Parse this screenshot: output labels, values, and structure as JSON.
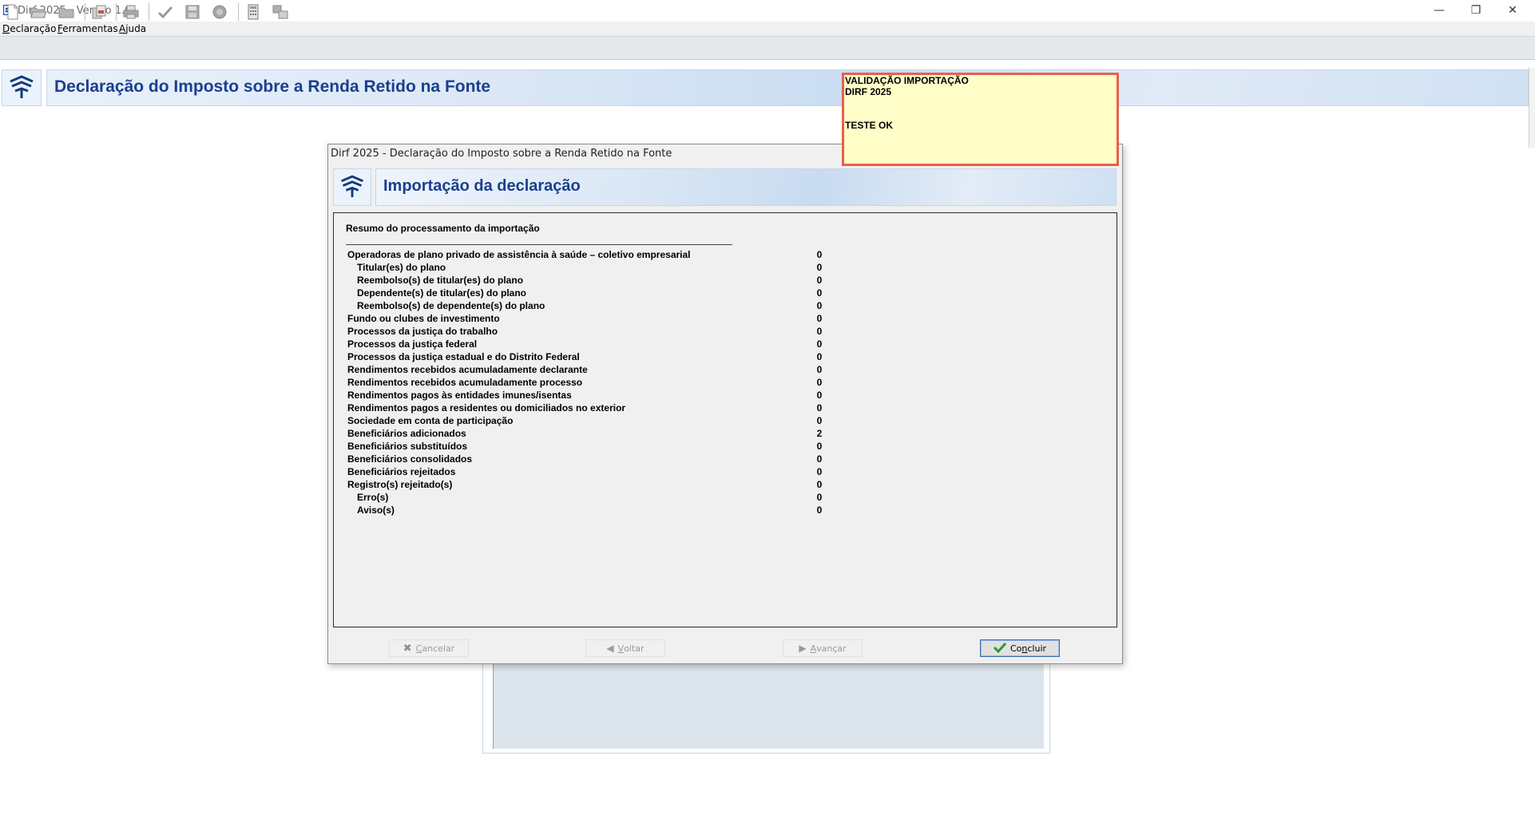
{
  "window": {
    "title": "Dirf 2025 - Versão 1.0",
    "minimize": "—",
    "restore": "❐",
    "close": "✕"
  },
  "menu": {
    "items": [
      {
        "underline": "D",
        "rest": "eclaração"
      },
      {
        "underline": "F",
        "rest": "erramentas"
      },
      {
        "underline": "A",
        "rest": "juda"
      }
    ]
  },
  "toolbar": {
    "icons": [
      "new-document-icon",
      "open-folder-icon",
      "folder-icon",
      "copy-icon",
      "print-icon",
      "check-icon",
      "save-icon",
      "stamp-icon",
      "calculator-icon",
      "transmit-icon"
    ]
  },
  "main": {
    "title": "Declaração do Imposto sobre a Renda Retido na Fonte"
  },
  "dialog": {
    "title": "Dirf 2025 - Declaração do Imposto sobre a Renda Retido na Fonte",
    "heading": "Importação da declaração",
    "summary_heading": "Resumo do processamento da importação",
    "rows": [
      {
        "label": "Operadoras de plano privado de assistência à saúde – coletivo empresarial",
        "value": "0",
        "indent": 0
      },
      {
        "label": "Titular(es) do plano",
        "value": "0",
        "indent": 1
      },
      {
        "label": "Reembolso(s) de titular(es) do plano",
        "value": "0",
        "indent": 1
      },
      {
        "label": "Dependente(s) de titular(es) do plano",
        "value": "0",
        "indent": 1
      },
      {
        "label": "Reembolso(s) de dependente(s) do plano",
        "value": "0",
        "indent": 1
      },
      {
        "label": "Fundo ou clubes de investimento",
        "value": "0",
        "indent": 0
      },
      {
        "label": "Processos da justiça do trabalho",
        "value": "0",
        "indent": 0
      },
      {
        "label": "Processos da justiça federal",
        "value": "0",
        "indent": 0
      },
      {
        "label": "Processos da justiça estadual e do Distrito Federal",
        "value": "0",
        "indent": 0
      },
      {
        "label": "Rendimentos recebidos acumuladamente declarante",
        "value": "0",
        "indent": 0
      },
      {
        "label": "Rendimentos recebidos acumuladamente processo",
        "value": "0",
        "indent": 0
      },
      {
        "label": "Rendimentos pagos às entidades imunes/isentas",
        "value": "0",
        "indent": 0
      },
      {
        "label": "Rendimentos pagos a residentes ou domiciliados no exterior",
        "value": "0",
        "indent": 0
      },
      {
        "label": "Sociedade em conta de participação",
        "value": "0",
        "indent": 0
      },
      {
        "label": "Beneficiários adicionados",
        "value": "2",
        "indent": 0
      },
      {
        "label": "Beneficiários substituídos",
        "value": "0",
        "indent": 0
      },
      {
        "label": "Beneficiários consolidados",
        "value": "0",
        "indent": 0
      },
      {
        "label": "Beneficiários rejeitados",
        "value": "0",
        "indent": 0
      },
      {
        "label": "Registro(s) rejeitado(s)",
        "value": "0",
        "indent": 0
      },
      {
        "label": "Erro(s)",
        "value": "0",
        "indent": 1
      },
      {
        "label": "Aviso(s)",
        "value": "0",
        "indent": 1
      }
    ],
    "buttons": {
      "cancel": {
        "underline": "C",
        "rest": "ancelar",
        "enabled": false
      },
      "back": {
        "underline": "V",
        "rest": "oltar",
        "enabled": false
      },
      "next": {
        "underline": "A",
        "rest": "vançar",
        "enabled": false
      },
      "finish": {
        "pre": "Co",
        "underline": "n",
        "rest": "cluir",
        "enabled": true
      }
    }
  },
  "note": {
    "line1": "VALIDAÇÃO IMPORTAÇÃO",
    "line2": "DIRF 2025",
    "line3": "TESTE OK",
    "border_color": "#e8604c",
    "background": "#fffdc8"
  },
  "colors": {
    "title_blue": "#1b3f8f"
  }
}
